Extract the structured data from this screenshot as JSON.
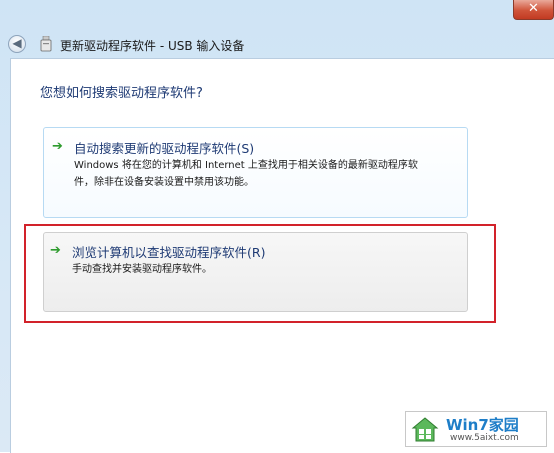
{
  "window": {
    "title": "更新驱动程序软件 - USB 输入设备",
    "close_glyph": "✕",
    "back_glyph": "◀"
  },
  "main": {
    "question": "您想如何搜索驱动程序软件?",
    "options": [
      {
        "arrow": "➔",
        "title": "自动搜索更新的驱动程序软件(S)",
        "desc_line1": "Windows 将在您的计算机和 Internet 上查找用于相关设备的最新驱动程序软",
        "desc_line2": "件，除非在设备安装设置中禁用该功能。"
      },
      {
        "arrow": "➔",
        "title": "浏览计算机以查找驱动程序软件(R)",
        "desc_line1": "手动查找并安装驱动程序软件。"
      }
    ]
  },
  "watermark": {
    "name": "Win7家园",
    "url": "www.5aixt.com"
  },
  "colors": {
    "accent_blue": "#1e3a74",
    "arrow_green": "#2e9b2e",
    "highlight_red": "#d2222a"
  }
}
